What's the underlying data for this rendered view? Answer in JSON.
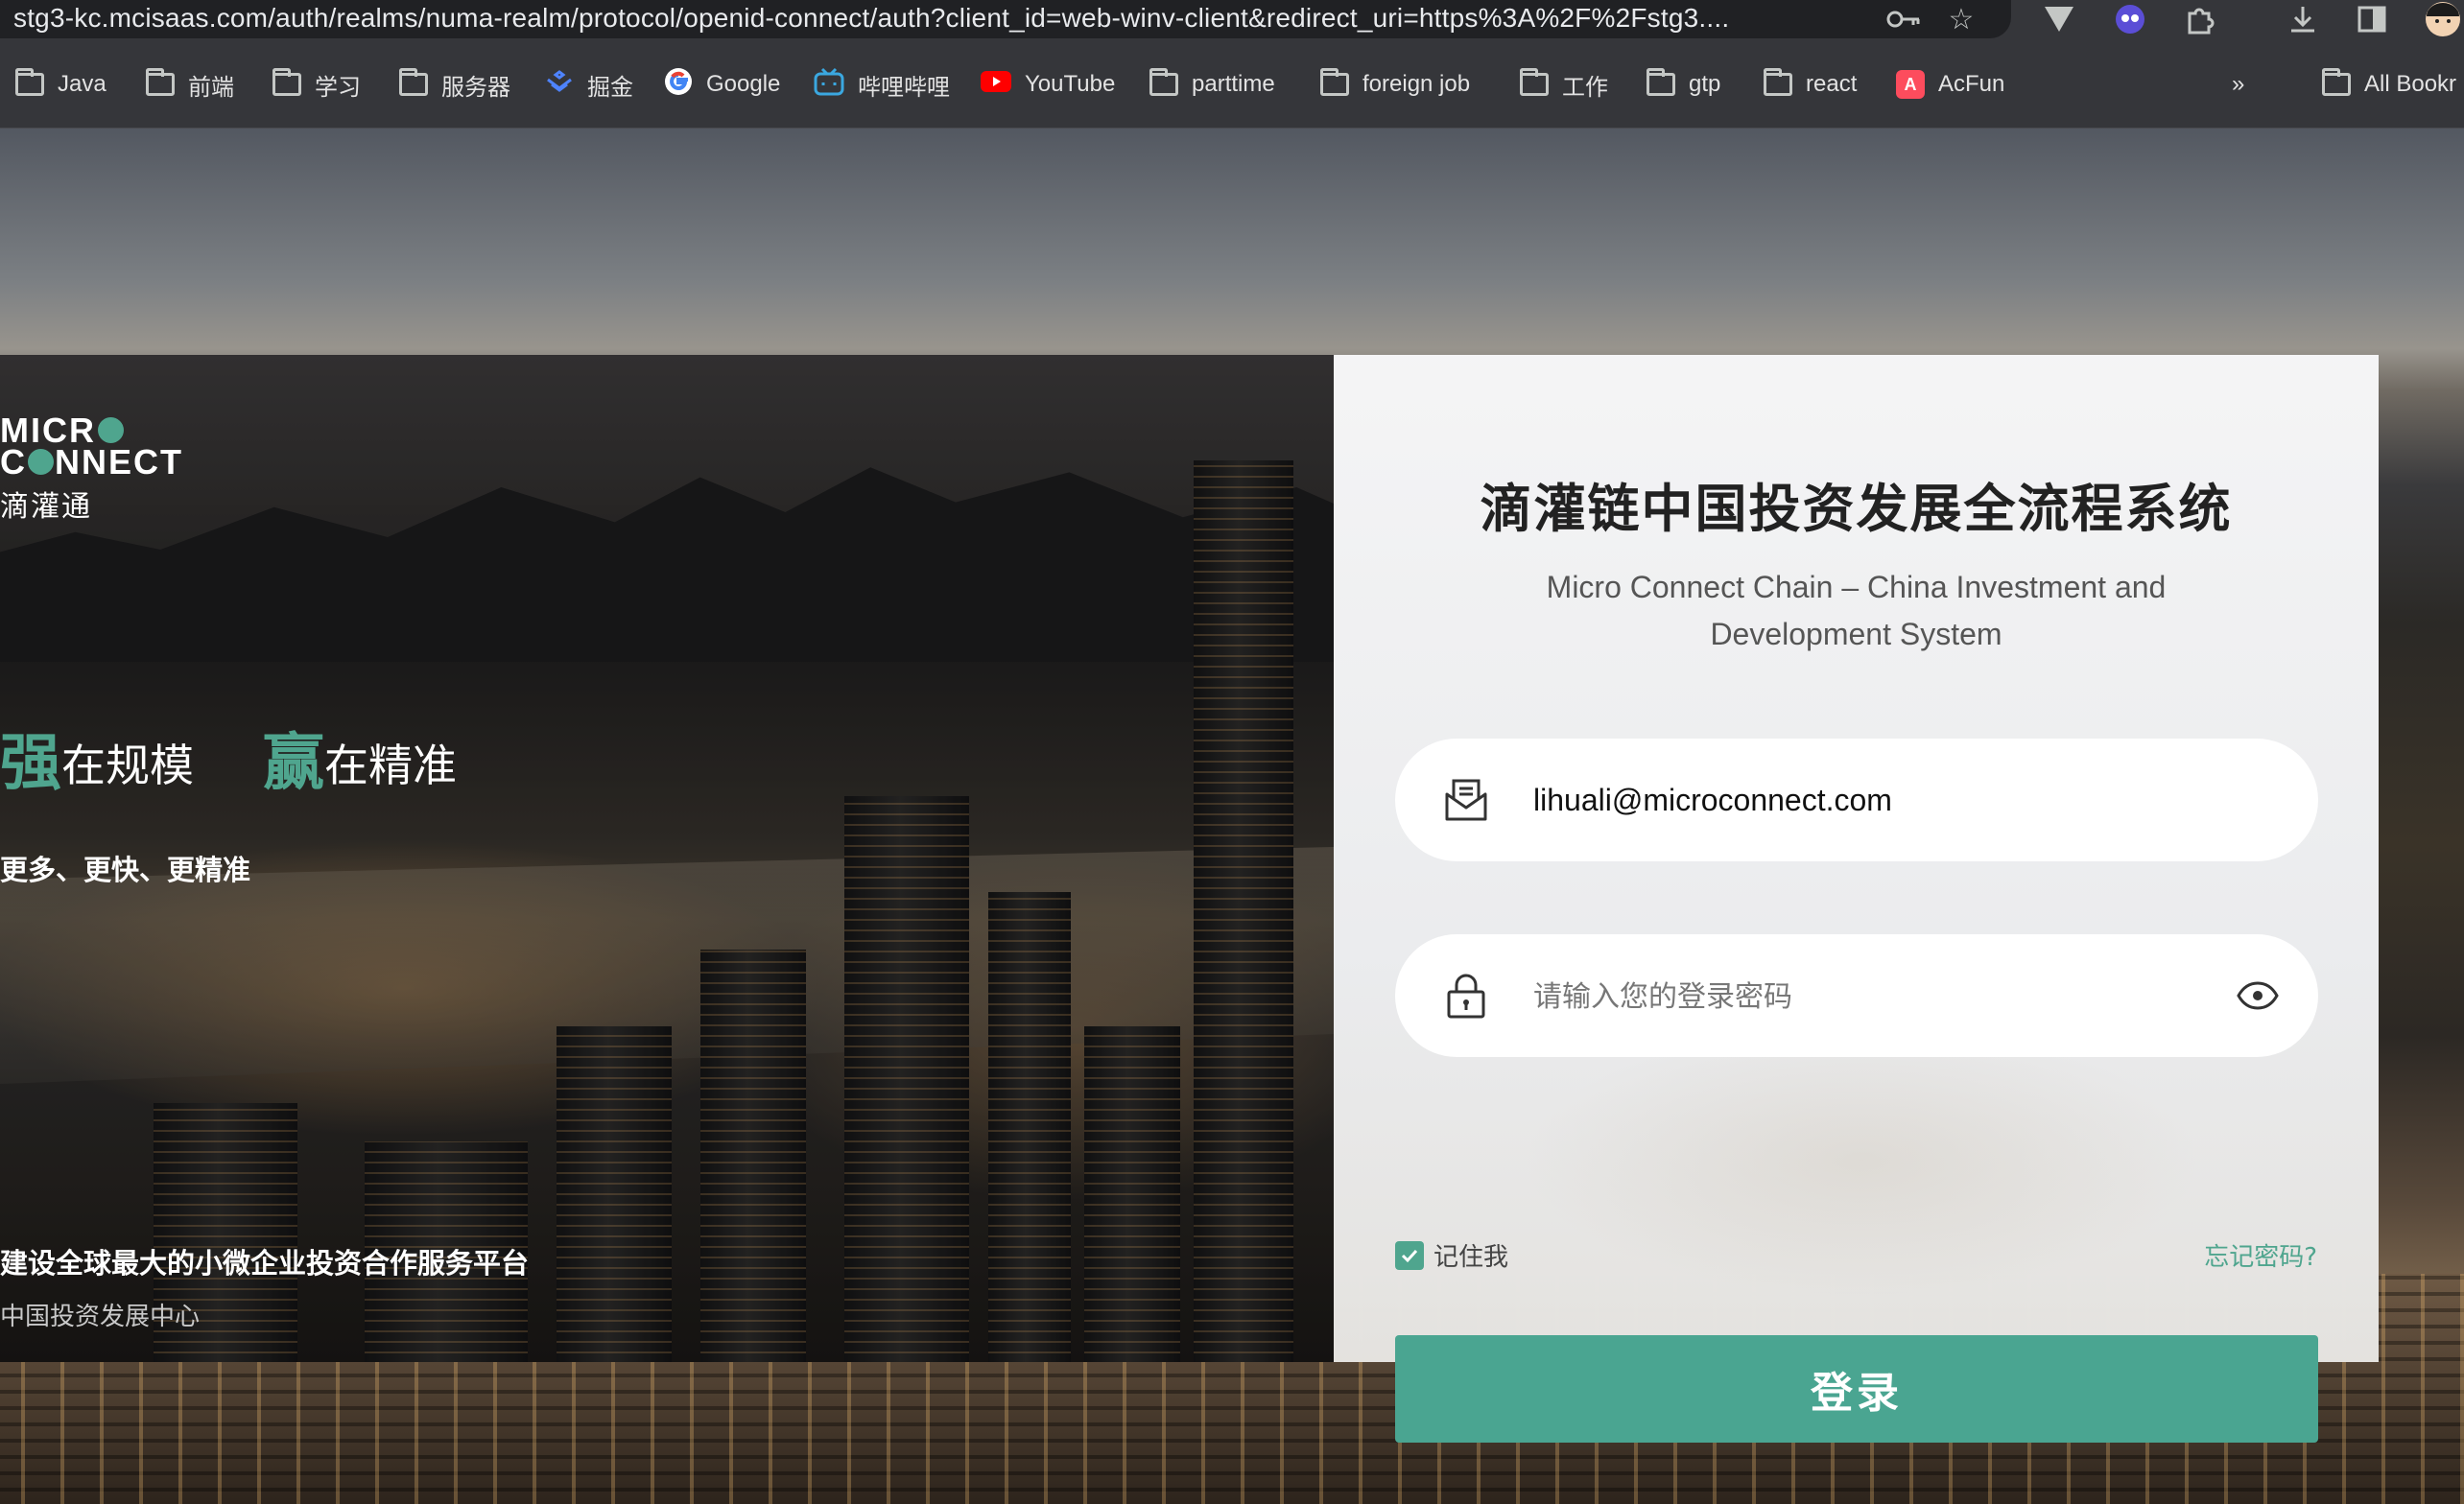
{
  "browser": {
    "url": "stg3-kc.mcisaas.com/auth/realms/numa-realm/protocol/openid-connect/auth?client_id=web-winv-client&redirect_uri=https%3A%2F%2Fstg3....",
    "bookmarks": [
      {
        "label": "Java",
        "icon": "folder-icon"
      },
      {
        "label": "前端",
        "icon": "folder-icon"
      },
      {
        "label": "学习",
        "icon": "folder-icon"
      },
      {
        "label": "服务器",
        "icon": "folder-icon"
      },
      {
        "label": "掘金",
        "icon": "juejin-icon"
      },
      {
        "label": "Google",
        "icon": "google-icon"
      },
      {
        "label": "哔哩哔哩",
        "icon": "bilibili-icon"
      },
      {
        "label": "YouTube",
        "icon": "youtube-icon"
      },
      {
        "label": "parttime",
        "icon": "folder-icon"
      },
      {
        "label": "foreign job",
        "icon": "folder-icon"
      },
      {
        "label": "工作",
        "icon": "folder-icon"
      },
      {
        "label": "gtp",
        "icon": "folder-icon"
      },
      {
        "label": "react",
        "icon": "folder-icon"
      },
      {
        "label": "AcFun",
        "icon": "acfun-icon"
      }
    ],
    "more_label": "»",
    "all_bookmarks": "All Bookr"
  },
  "hero": {
    "logo_line1_a": "MICR",
    "logo_line2_a": "C",
    "logo_line2_b": "NNECT",
    "logo_cn": "滴灌通",
    "slogan_hl1": "强",
    "slogan_t1": "在规模",
    "slogan_hl2": "赢",
    "slogan_t2": "在精准",
    "subslogan": "更多、更快、更精准",
    "mission": "建设全球最大的小微企业投资合作服务平台",
    "mission_sub": "中国投资发展中心"
  },
  "login": {
    "title": "滴灌链中国投资发展全流程系统",
    "subtitle": "Micro Connect Chain – China Investment and Development System",
    "username_value": "lihuali@microconnect.com",
    "password_placeholder": "请输入您的登录密码",
    "remember_label": "记住我",
    "remember_checked": true,
    "forgot_label": "忘记密码?",
    "submit_label": "登录"
  },
  "colors": {
    "accent": "#4fa58e",
    "button": "#4aa591"
  }
}
